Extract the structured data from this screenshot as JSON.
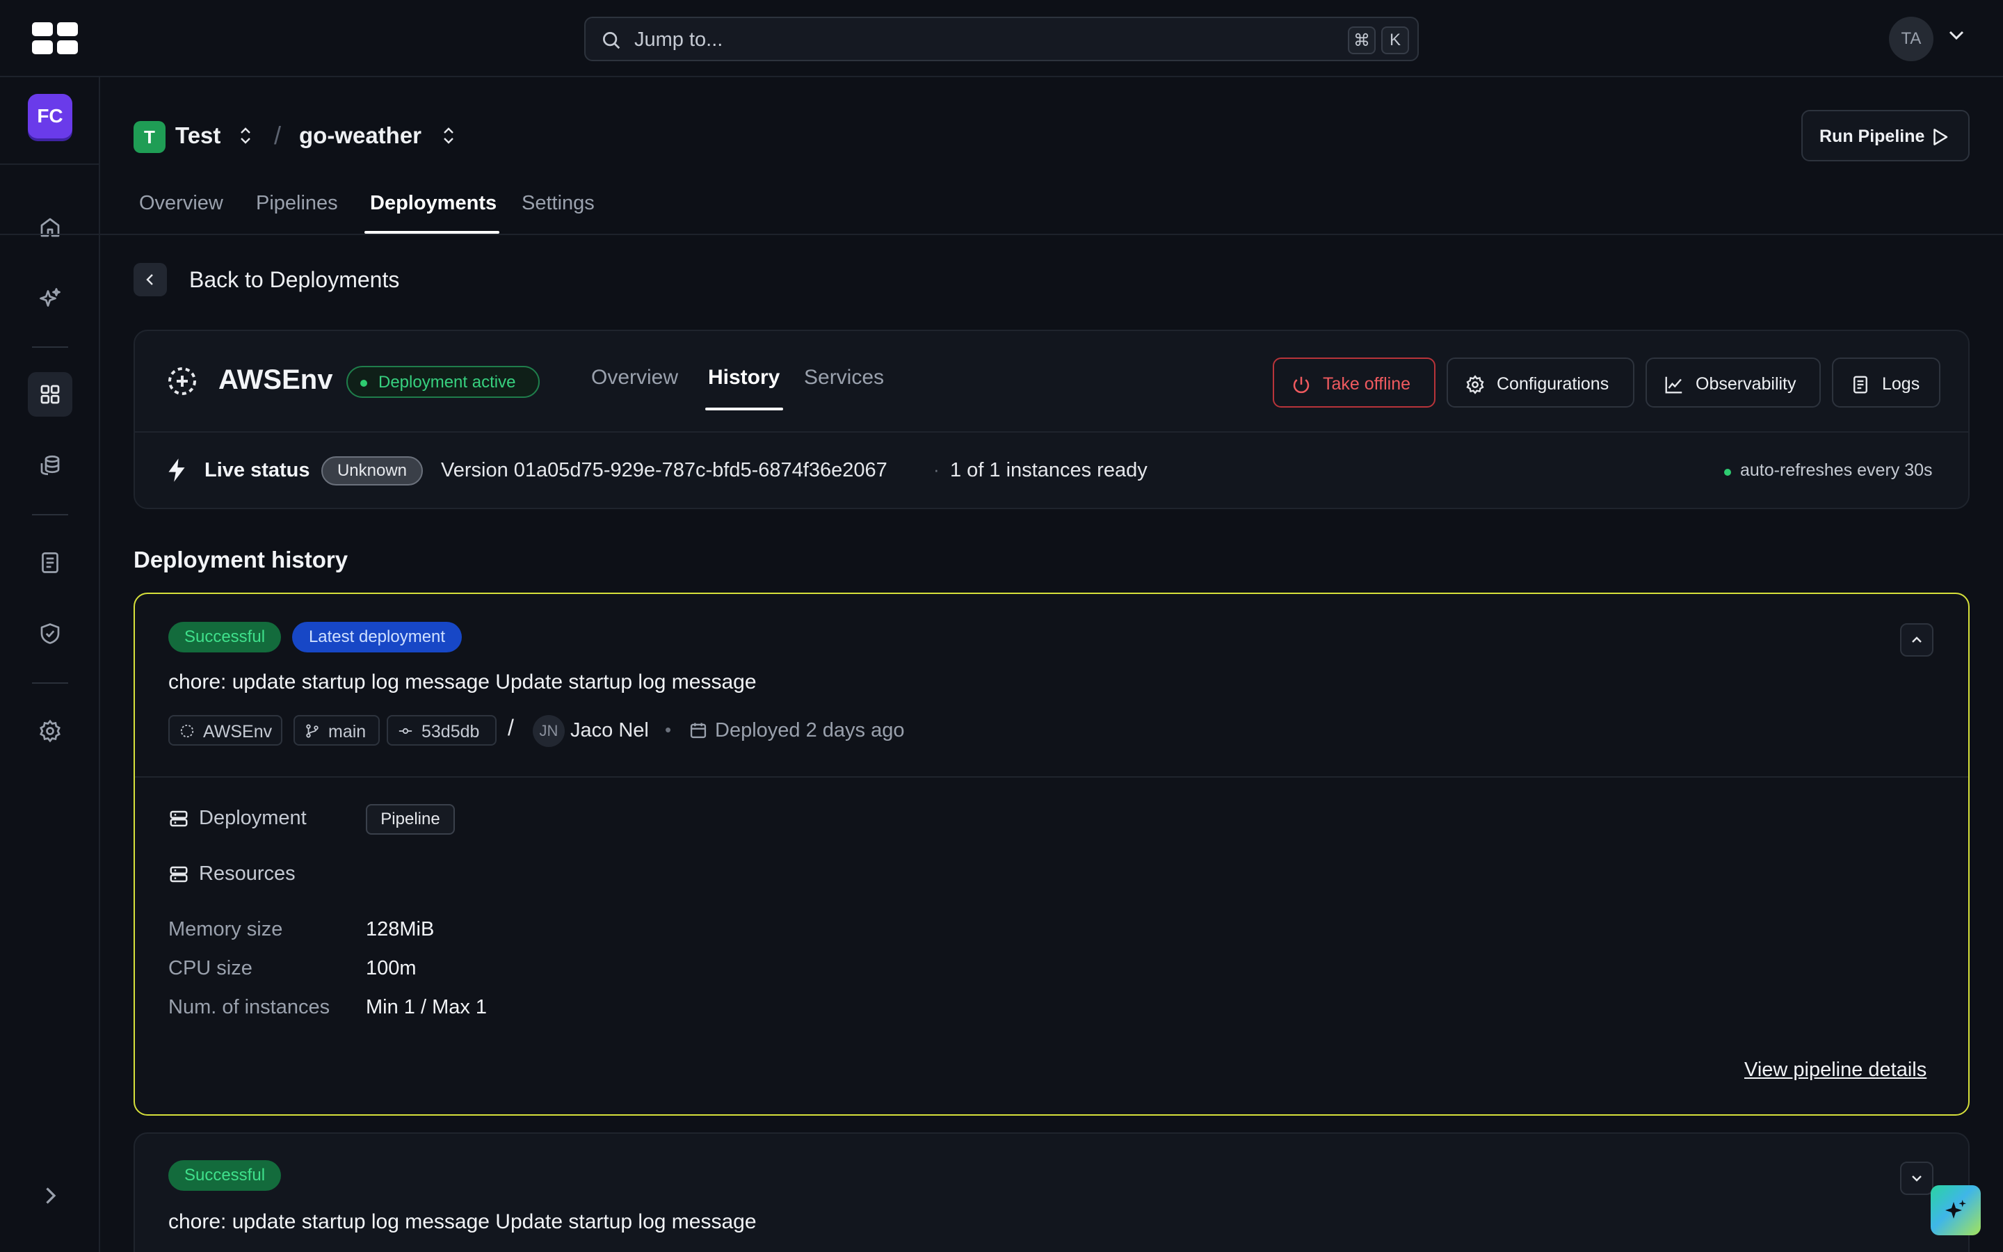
{
  "topbar": {
    "search_placeholder": "Jump to...",
    "shortcut_cmd": "⌘",
    "shortcut_key": "K",
    "user_initials": "TA"
  },
  "sidebar": {
    "workspace_initials": "FC",
    "items": [
      {
        "icon": "home-icon"
      },
      {
        "icon": "sparkles-icon"
      },
      {
        "icon": "grid-icon",
        "active": true
      },
      {
        "icon": "database-icon"
      },
      {
        "icon": "document-icon"
      },
      {
        "icon": "shield-icon"
      },
      {
        "icon": "gear-icon"
      }
    ]
  },
  "header": {
    "project_badge": "T",
    "project_name": "Test",
    "separator": "/",
    "repo_name": "go-weather",
    "run_pipeline_label": "Run Pipeline"
  },
  "tabs": [
    {
      "label": "Overview"
    },
    {
      "label": "Pipelines"
    },
    {
      "label": "Deployments",
      "active": true
    },
    {
      "label": "Settings"
    }
  ],
  "back_label": "Back to Deployments",
  "environment": {
    "name": "AWSEnv",
    "status": "Deployment active",
    "tabs": [
      {
        "label": "Overview"
      },
      {
        "label": "History",
        "active": true
      },
      {
        "label": "Services"
      }
    ],
    "actions": {
      "take_offline": "Take offline",
      "configurations": "Configurations",
      "observability": "Observability",
      "logs": "Logs"
    },
    "live_status_label": "Live status",
    "live_status_value": "Unknown",
    "version_text": "Version  01a05d75-929e-787c-bfd5-6874f36e2067",
    "separator_dot": "·",
    "instances_text": "1 of 1  instances ready",
    "refresh_text": "auto-refreshes every 30s"
  },
  "history": {
    "title": "Deployment history",
    "entries": [
      {
        "status": "Successful",
        "tag": "Latest deployment",
        "message": "chore: update startup log message Update startup log message",
        "environment": "AWSEnv",
        "branch": "main",
        "commit": "53d5db",
        "slash": "/",
        "author_initials": "JN",
        "author": "Jaco Nel",
        "meta_dot": "•",
        "deployed": "Deployed 2 days ago",
        "deployment_label": "Deployment",
        "deployment_type": "Pipeline",
        "resources_label": "Resources",
        "resources": [
          {
            "key": "Memory size",
            "value": "128MiB"
          },
          {
            "key": "CPU size",
            "value": "100m"
          },
          {
            "key": "Num. of instances",
            "value": "Min 1 / Max 1"
          }
        ],
        "link": "View pipeline details",
        "expanded": true
      },
      {
        "status": "Successful",
        "message": "chore: update startup log message Update startup log message",
        "expanded": false
      }
    ]
  },
  "colors": {
    "background": "#0d1017",
    "accent_active_card": "#d6e03b",
    "success": "#2ecc71",
    "danger": "#ef5a5f",
    "workspace": "#6a3bea"
  }
}
